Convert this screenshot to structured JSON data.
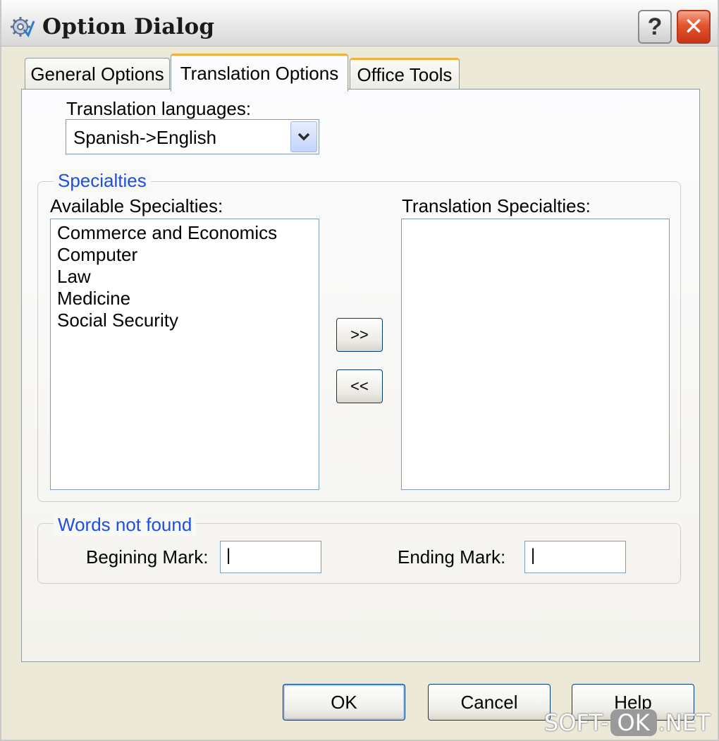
{
  "window": {
    "title": "Option Dialog",
    "help_glyph": "?",
    "close_glyph": "✕"
  },
  "tabs": [
    {
      "label": "General Options",
      "active": false
    },
    {
      "label": "Translation Options",
      "active": true
    },
    {
      "label": "Office Tools",
      "active": false
    }
  ],
  "translation": {
    "languages_label": "Translation languages:",
    "languages_value": "Spanish->English"
  },
  "specialties": {
    "group_title": "Specialties",
    "available_label": "Available Specialties:",
    "available_items": [
      "Commerce and Economics",
      "Computer",
      "Law",
      "Medicine",
      "Social Security"
    ],
    "translation_label": "Translation Specialties:",
    "translation_items": [],
    "add_label": ">>",
    "remove_label": "<<"
  },
  "words_not_found": {
    "group_title": "Words not found",
    "beginning_label": "Begining Mark:",
    "beginning_value": "|",
    "ending_label": "Ending Mark:",
    "ending_value": "|"
  },
  "buttons": {
    "ok": "OK",
    "cancel": "Cancel",
    "help": "Help"
  },
  "watermark": {
    "left": "SOFT-",
    "middle": "OK",
    "right": ".NET"
  },
  "colors": {
    "accent_blue": "#1e4fe0",
    "tab_highlight": "#f2b03a",
    "close_red": "#e4552e"
  }
}
